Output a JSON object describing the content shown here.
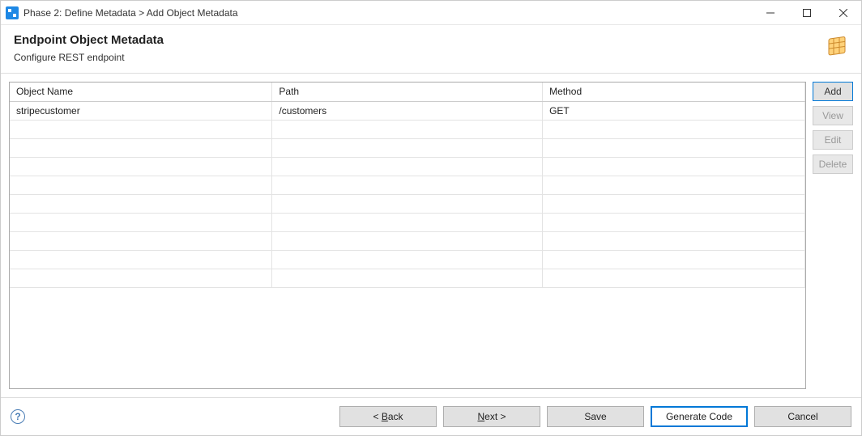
{
  "window": {
    "title": "Phase 2: Define Metadata > Add Object Metadata"
  },
  "header": {
    "title": "Endpoint Object Metadata",
    "subtitle": "Configure REST endpoint"
  },
  "table": {
    "columns": {
      "name": "Object Name",
      "path": "Path",
      "method": "Method"
    },
    "rows": [
      {
        "name": "stripecustomer",
        "path": "/customers",
        "method": "GET"
      }
    ]
  },
  "sideButtons": {
    "add": "Add",
    "view": "View",
    "edit": "Edit",
    "delete": "Delete"
  },
  "footer": {
    "back": "< Back",
    "next": "Next >",
    "save": "Save",
    "generate": "Generate Code",
    "cancel": "Cancel"
  }
}
